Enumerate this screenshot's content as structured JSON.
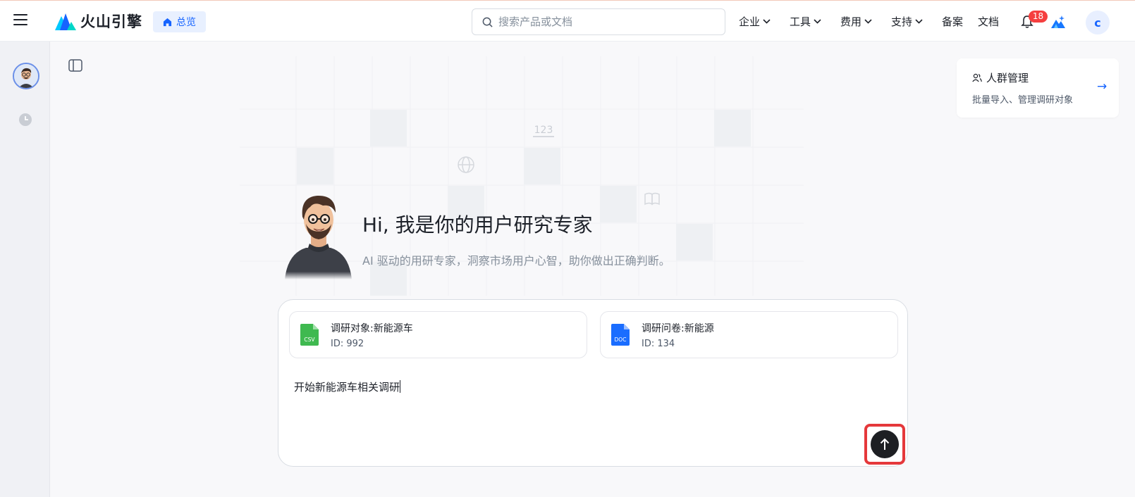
{
  "header": {
    "logo_text": "火山引擎",
    "overview_label": "总览",
    "search_placeholder": "搜索产品或文档",
    "nav": [
      {
        "label": "企业",
        "dropdown": true
      },
      {
        "label": "工具",
        "dropdown": true
      },
      {
        "label": "费用",
        "dropdown": true
      },
      {
        "label": "支持",
        "dropdown": true
      },
      {
        "label": "备案",
        "dropdown": false
      },
      {
        "label": "文档",
        "dropdown": false
      }
    ],
    "notification_count": "18",
    "user_initial": "c"
  },
  "crowd_card": {
    "title": "人群管理",
    "description": "批量导入、管理调研对象",
    "arrow": "→"
  },
  "hero": {
    "title": "Hi, 我是你的用户研究专家",
    "subtitle": "AI 驱动的用研专家，洞察市场用户心智，助你做出正确判断。"
  },
  "grid_labels": {
    "number": "123"
  },
  "attachments": [
    {
      "type_label": "CSV",
      "name": "调研对象:新能源车",
      "id_text": "ID: 992",
      "color": "#3fb950"
    },
    {
      "type_label": "DOC",
      "name": "调研问卷:新能源",
      "id_text": "ID: 134",
      "color": "#1a6dff"
    }
  ],
  "chat": {
    "input_text": "开始新能源车相关调研"
  },
  "colors": {
    "accent": "#1664ff",
    "badge": "#f53f3f",
    "highlight_frame": "#e5383b"
  }
}
